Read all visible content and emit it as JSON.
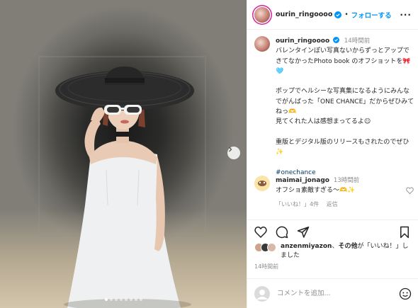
{
  "header": {
    "username": "ourin_ringoooo",
    "separator": "•",
    "follow_label": "フォローする",
    "more_label": "···"
  },
  "caption": {
    "username": "ourin_ringoooo",
    "time": "14時間前",
    "text": "バレンタインぽい写真ないからずっとアップできてなかったPhoto book のオフショットを🎀🩵\n\nポップでヘルシーな写真集になるようにみんなでがんばった「ONE CHANCE」だからぜひみてねっ🫶\n見てくれた人は感想まってるよ☺︎\n\n重版とデジタル版のリリースもされたのでぜひ✨",
    "hashtag": "#onechance"
  },
  "comment": {
    "username": "maimai_jonago",
    "time": "13時間前",
    "text": "オフショ素敵すぎる〜🫶✨",
    "likes": "「いいね！」4件",
    "reply": "返信"
  },
  "likes": {
    "user": "anzenmiyazon",
    "sep": "、",
    "others": "その他",
    "suffix": "が「いいね！」しました"
  },
  "post_time": "14時間前",
  "comment_input": {
    "placeholder": "コメントを追加..."
  },
  "photo": {
    "slide_count": 8,
    "active_slide": 1
  },
  "icons": [
    "verified-badge-icon",
    "heart-icon",
    "comment-icon",
    "share-icon",
    "bookmark-icon",
    "next-arrow-icon",
    "emoji-icon"
  ],
  "colors": {
    "link": "#0095f6",
    "verified": "#0095f6",
    "muted": "#8e8e8e",
    "hashtag": "#00376b"
  }
}
